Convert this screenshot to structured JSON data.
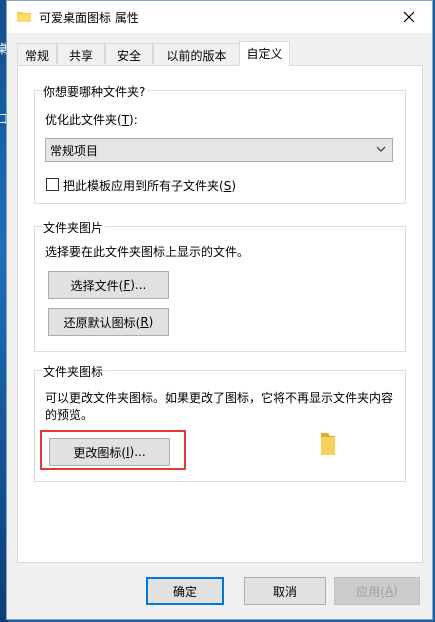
{
  "desktop": {
    "left_fragment_1": "桌",
    "left_fragment_2": "口"
  },
  "window": {
    "title": "可爱桌面图标 属性"
  },
  "tabs": [
    {
      "label": "常规"
    },
    {
      "label": "共享"
    },
    {
      "label": "安全"
    },
    {
      "label": "以前的版本"
    },
    {
      "label": "自定义"
    }
  ],
  "group1": {
    "title": "你想要哪种文件夹?",
    "optimize_label_prefix": "优化此文件夹(",
    "optimize_label_key": "T",
    "optimize_label_suffix": "):",
    "select_value": "常规项目",
    "checkbox_label_prefix": "把此模板应用到所有子文件夹(",
    "checkbox_label_key": "S",
    "checkbox_label_suffix": ")",
    "checkbox_checked": false
  },
  "group2": {
    "title": "文件夹图片",
    "description": "选择要在此文件夹图标上显示的文件。",
    "choose_prefix": "选择文件(",
    "choose_key": "F",
    "choose_suffix": ")...",
    "restore_prefix": "还原默认图标(",
    "restore_key": "R",
    "restore_suffix": ")"
  },
  "group3": {
    "title": "文件夹图标",
    "description_line1": "可以更改文件夹图标。如果更改了图标，它将不再显示文件夹内容",
    "description_line2": "的预览。",
    "change_prefix": "更改图标(",
    "change_key": "I",
    "change_suffix": ")..."
  },
  "footer": {
    "ok": "确定",
    "cancel": "取消",
    "apply_prefix": "应用(",
    "apply_key": "A",
    "apply_suffix": ")"
  },
  "colors": {
    "highlight_box": "#e53935",
    "accent": "#0078d7",
    "folder": "#f6c94a"
  }
}
